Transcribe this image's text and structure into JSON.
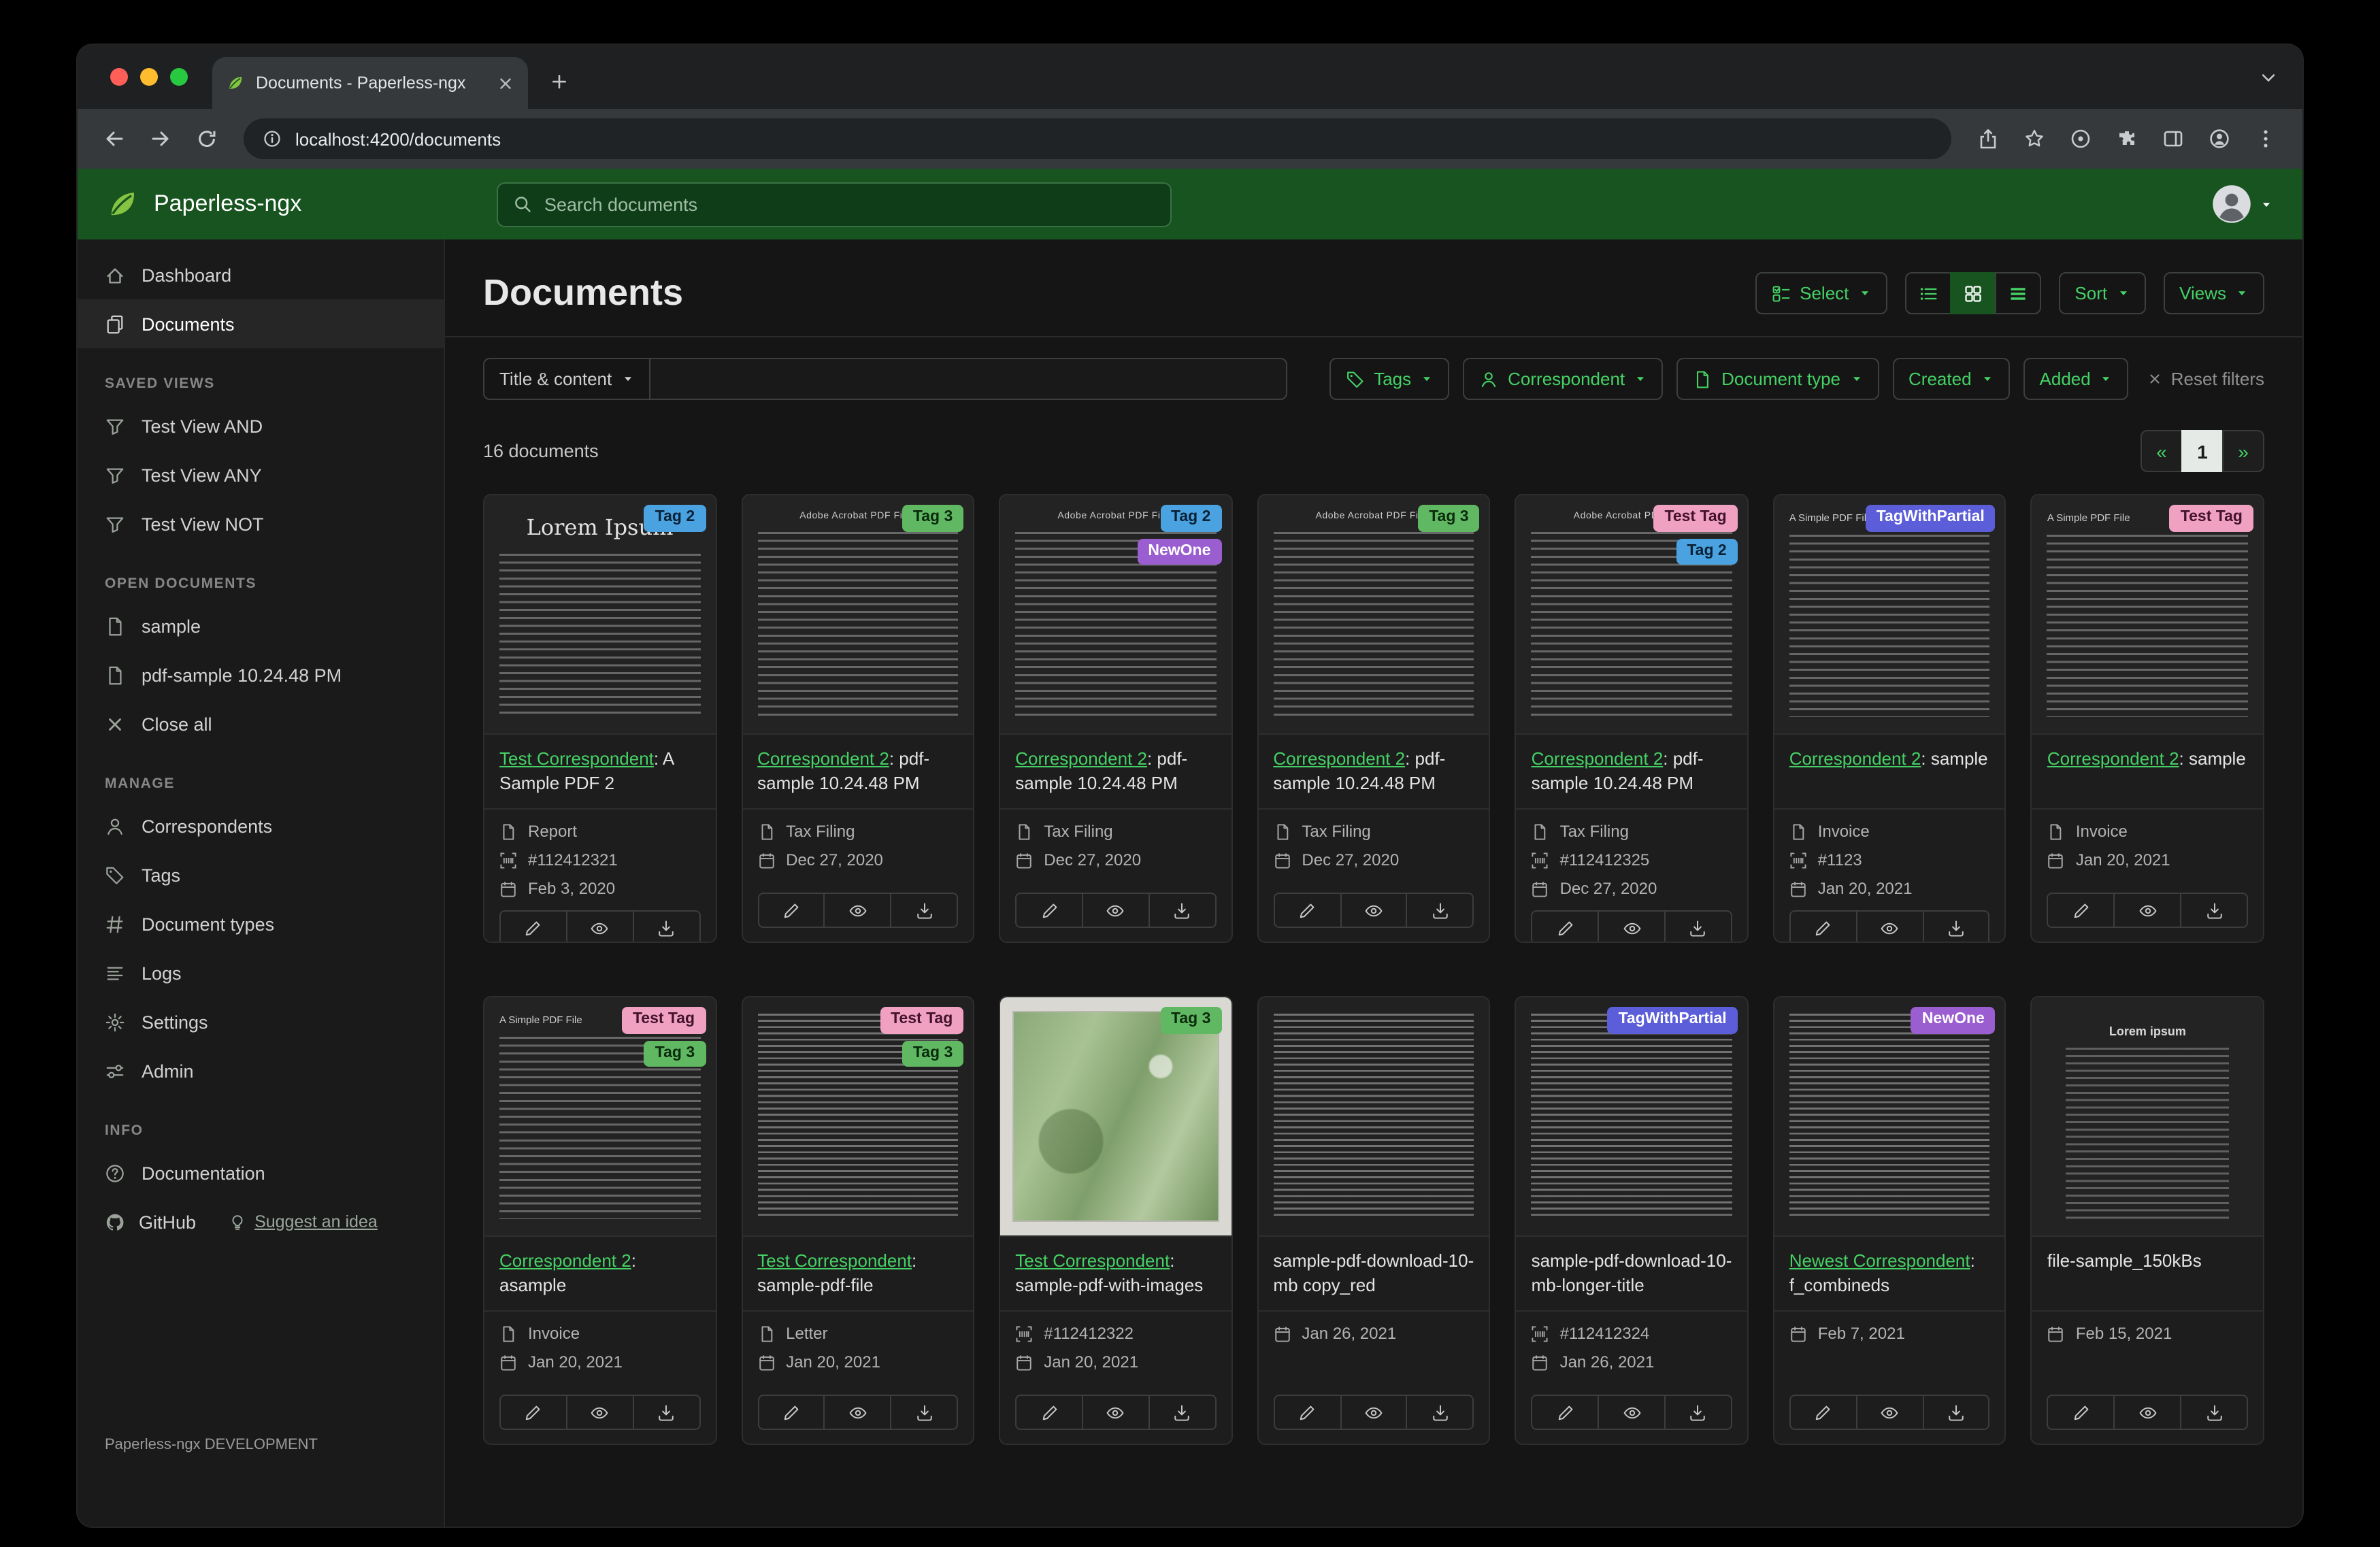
{
  "colors": {
    "accent_green": "#17541f",
    "link_green": "#45d165"
  },
  "browser": {
    "tab_title": "Documents - Paperless-ngx",
    "url": "localhost:4200/documents"
  },
  "app_header": {
    "app_name": "Paperless-ngx",
    "search_placeholder": "Search documents"
  },
  "sidebar": {
    "primary_items": [
      {
        "label": "Dashboard",
        "icon": "house",
        "active": false
      },
      {
        "label": "Documents",
        "icon": "files",
        "active": true
      }
    ],
    "sections": [
      {
        "title": "SAVED VIEWS",
        "items": [
          {
            "label": "Test View AND",
            "icon": "funnel"
          },
          {
            "label": "Test View ANY",
            "icon": "funnel"
          },
          {
            "label": "Test View NOT",
            "icon": "funnel"
          }
        ]
      },
      {
        "title": "OPEN DOCUMENTS",
        "items": [
          {
            "label": "sample",
            "icon": "file"
          },
          {
            "label": "pdf-sample 10.24.48 PM",
            "icon": "file"
          },
          {
            "label": "Close all",
            "icon": "x"
          }
        ]
      },
      {
        "title": "MANAGE",
        "items": [
          {
            "label": "Correspondents",
            "icon": "person"
          },
          {
            "label": "Tags",
            "icon": "tag"
          },
          {
            "label": "Document types",
            "icon": "hash"
          },
          {
            "label": "Logs",
            "icon": "list"
          },
          {
            "label": "Settings",
            "icon": "gear"
          },
          {
            "label": "Admin",
            "icon": "toggles"
          }
        ]
      },
      {
        "title": "INFO",
        "items": [
          {
            "label": "Documentation",
            "icon": "question"
          }
        ]
      }
    ],
    "github_label": "GitHub",
    "suggest_label": "Suggest an idea",
    "footer": "Paperless-ngx DEVELOPMENT"
  },
  "page": {
    "title": "Documents",
    "select_label": "Select",
    "sort_label": "Sort",
    "views_label": "Views",
    "count_label": "16 documents"
  },
  "filters": {
    "title_content_label": "Title & content",
    "query_value": "",
    "buttons": [
      {
        "label": "Tags",
        "icon": "tag"
      },
      {
        "label": "Correspondent",
        "icon": "person"
      },
      {
        "label": "Document type",
        "icon": "file"
      },
      {
        "label": "Created",
        "icon": null
      },
      {
        "label": "Added",
        "icon": null
      }
    ],
    "reset_label": "Reset filters"
  },
  "pagination": {
    "prev": "«",
    "current": "1",
    "next": "»"
  },
  "tag_colors": {
    "Tag 2": {
      "bg": "#4aa3e0",
      "fg": "#0b2136"
    },
    "Tag 3": {
      "bg": "#60b962",
      "fg": "#0c2a0d"
    },
    "NewOne": {
      "bg": "#9a5ed1",
      "fg": "#ffffff"
    },
    "Test Tag": {
      "bg": "#f0a1c2",
      "fg": "#43132a"
    },
    "TagWithPartial": {
      "bg": "#5b5ed8",
      "fg": "#ffffff"
    }
  },
  "documents": [
    {
      "tags": [
        "Tag 2"
      ],
      "thumb": {
        "kind": "serif",
        "heading": "Lorem Ipsum"
      },
      "correspondent": "Test Correspondent",
      "title": "A Sample PDF 2",
      "meta": [
        {
          "type": "doctype",
          "text": "Report"
        },
        {
          "type": "asn",
          "text": "#112412321"
        },
        {
          "type": "date",
          "text": "Feb 3, 2020"
        }
      ]
    },
    {
      "tags": [
        "Tag 3"
      ],
      "thumb": {
        "kind": "acrobat",
        "heading": "Adobe Acrobat PDF Files"
      },
      "correspondent": "Correspondent 2",
      "title": "pdf-sample 10.24.48 PM",
      "meta": [
        {
          "type": "doctype",
          "text": "Tax Filing"
        },
        {
          "type": "date",
          "text": "Dec 27, 2020"
        }
      ]
    },
    {
      "tags": [
        "Tag 2",
        "NewOne"
      ],
      "thumb": {
        "kind": "acrobat",
        "heading": "Adobe Acrobat PDF Files"
      },
      "correspondent": "Correspondent 2",
      "title": "pdf-sample 10.24.48 PM",
      "meta": [
        {
          "type": "doctype",
          "text": "Tax Filing"
        },
        {
          "type": "date",
          "text": "Dec 27, 2020"
        }
      ]
    },
    {
      "tags": [
        "Tag 3"
      ],
      "thumb": {
        "kind": "acrobat",
        "heading": "Adobe Acrobat PDF Files"
      },
      "correspondent": "Correspondent 2",
      "title": "pdf-sample 10.24.48 PM",
      "meta": [
        {
          "type": "doctype",
          "text": "Tax Filing"
        },
        {
          "type": "date",
          "text": "Dec 27, 2020"
        }
      ]
    },
    {
      "tags": [
        "Test Tag",
        "Tag 2"
      ],
      "thumb": {
        "kind": "acrobat",
        "heading": "Adobe Acrobat PDF Files"
      },
      "correspondent": "Correspondent 2",
      "title": "pdf-sample 10.24.48 PM",
      "meta": [
        {
          "type": "doctype",
          "text": "Tax Filing"
        },
        {
          "type": "asn",
          "text": "#112412325"
        },
        {
          "type": "date",
          "text": "Dec 27, 2020"
        }
      ]
    },
    {
      "tags": [
        "TagWithPartial"
      ],
      "thumb": {
        "kind": "simple",
        "heading": "A Simple PDF File"
      },
      "correspondent": "Correspondent 2",
      "title": "sample",
      "meta": [
        {
          "type": "doctype",
          "text": "Invoice"
        },
        {
          "type": "asn",
          "text": "#1123"
        },
        {
          "type": "date",
          "text": "Jan 20, 2021"
        }
      ]
    },
    {
      "tags": [
        "Test Tag"
      ],
      "thumb": {
        "kind": "simple",
        "heading": "A Simple PDF File"
      },
      "correspondent": "Correspondent 2",
      "title": "sample",
      "meta": [
        {
          "type": "doctype",
          "text": "Invoice"
        },
        {
          "type": "date",
          "text": "Jan 20, 2021"
        }
      ]
    },
    {
      "tags": [
        "Test Tag",
        "Tag 3"
      ],
      "thumb": {
        "kind": "simple",
        "heading": "A Simple PDF File"
      },
      "correspondent": "Correspondent 2",
      "title": "asample",
      "meta": [
        {
          "type": "doctype",
          "text": "Invoice"
        },
        {
          "type": "date",
          "text": "Jan 20, 2021"
        }
      ]
    },
    {
      "tags": [
        "Test Tag",
        "Tag 3"
      ],
      "thumb": {
        "kind": "dense",
        "heading": null
      },
      "correspondent": "Test Correspondent",
      "title": "sample-pdf-file",
      "meta": [
        {
          "type": "doctype",
          "text": "Letter"
        },
        {
          "type": "date",
          "text": "Jan 20, 2021"
        }
      ]
    },
    {
      "tags": [
        "Tag 3"
      ],
      "thumb": {
        "kind": "map",
        "heading": null
      },
      "correspondent": "Test Correspondent",
      "title": "sample-pdf-with-images",
      "meta": [
        {
          "type": "asn",
          "text": "#112412322"
        },
        {
          "type": "date",
          "text": "Jan 20, 2021"
        }
      ]
    },
    {
      "tags": [],
      "thumb": {
        "kind": "dense",
        "heading": null
      },
      "correspondent": null,
      "title": "sample-pdf-download-10-mb copy_red",
      "meta": [
        {
          "type": "date",
          "text": "Jan 26, 2021"
        }
      ]
    },
    {
      "tags": [
        "TagWithPartial"
      ],
      "thumb": {
        "kind": "dense",
        "heading": null
      },
      "correspondent": null,
      "title": "sample-pdf-download-10-mb-longer-title",
      "meta": [
        {
          "type": "asn",
          "text": "#112412324"
        },
        {
          "type": "date",
          "text": "Jan 26, 2021"
        }
      ]
    },
    {
      "tags": [
        "NewOne"
      ],
      "thumb": {
        "kind": "dense",
        "heading": null
      },
      "correspondent": "Newest Correspondent",
      "title": "f_combineds",
      "meta": [
        {
          "type": "date",
          "text": "Feb 7, 2021"
        }
      ]
    },
    {
      "tags": [],
      "thumb": {
        "kind": "centered",
        "heading": "Lorem ipsum"
      },
      "correspondent": null,
      "title": "file-sample_150kBs",
      "meta": [
        {
          "type": "date",
          "text": "Feb 15, 2021"
        }
      ]
    }
  ]
}
